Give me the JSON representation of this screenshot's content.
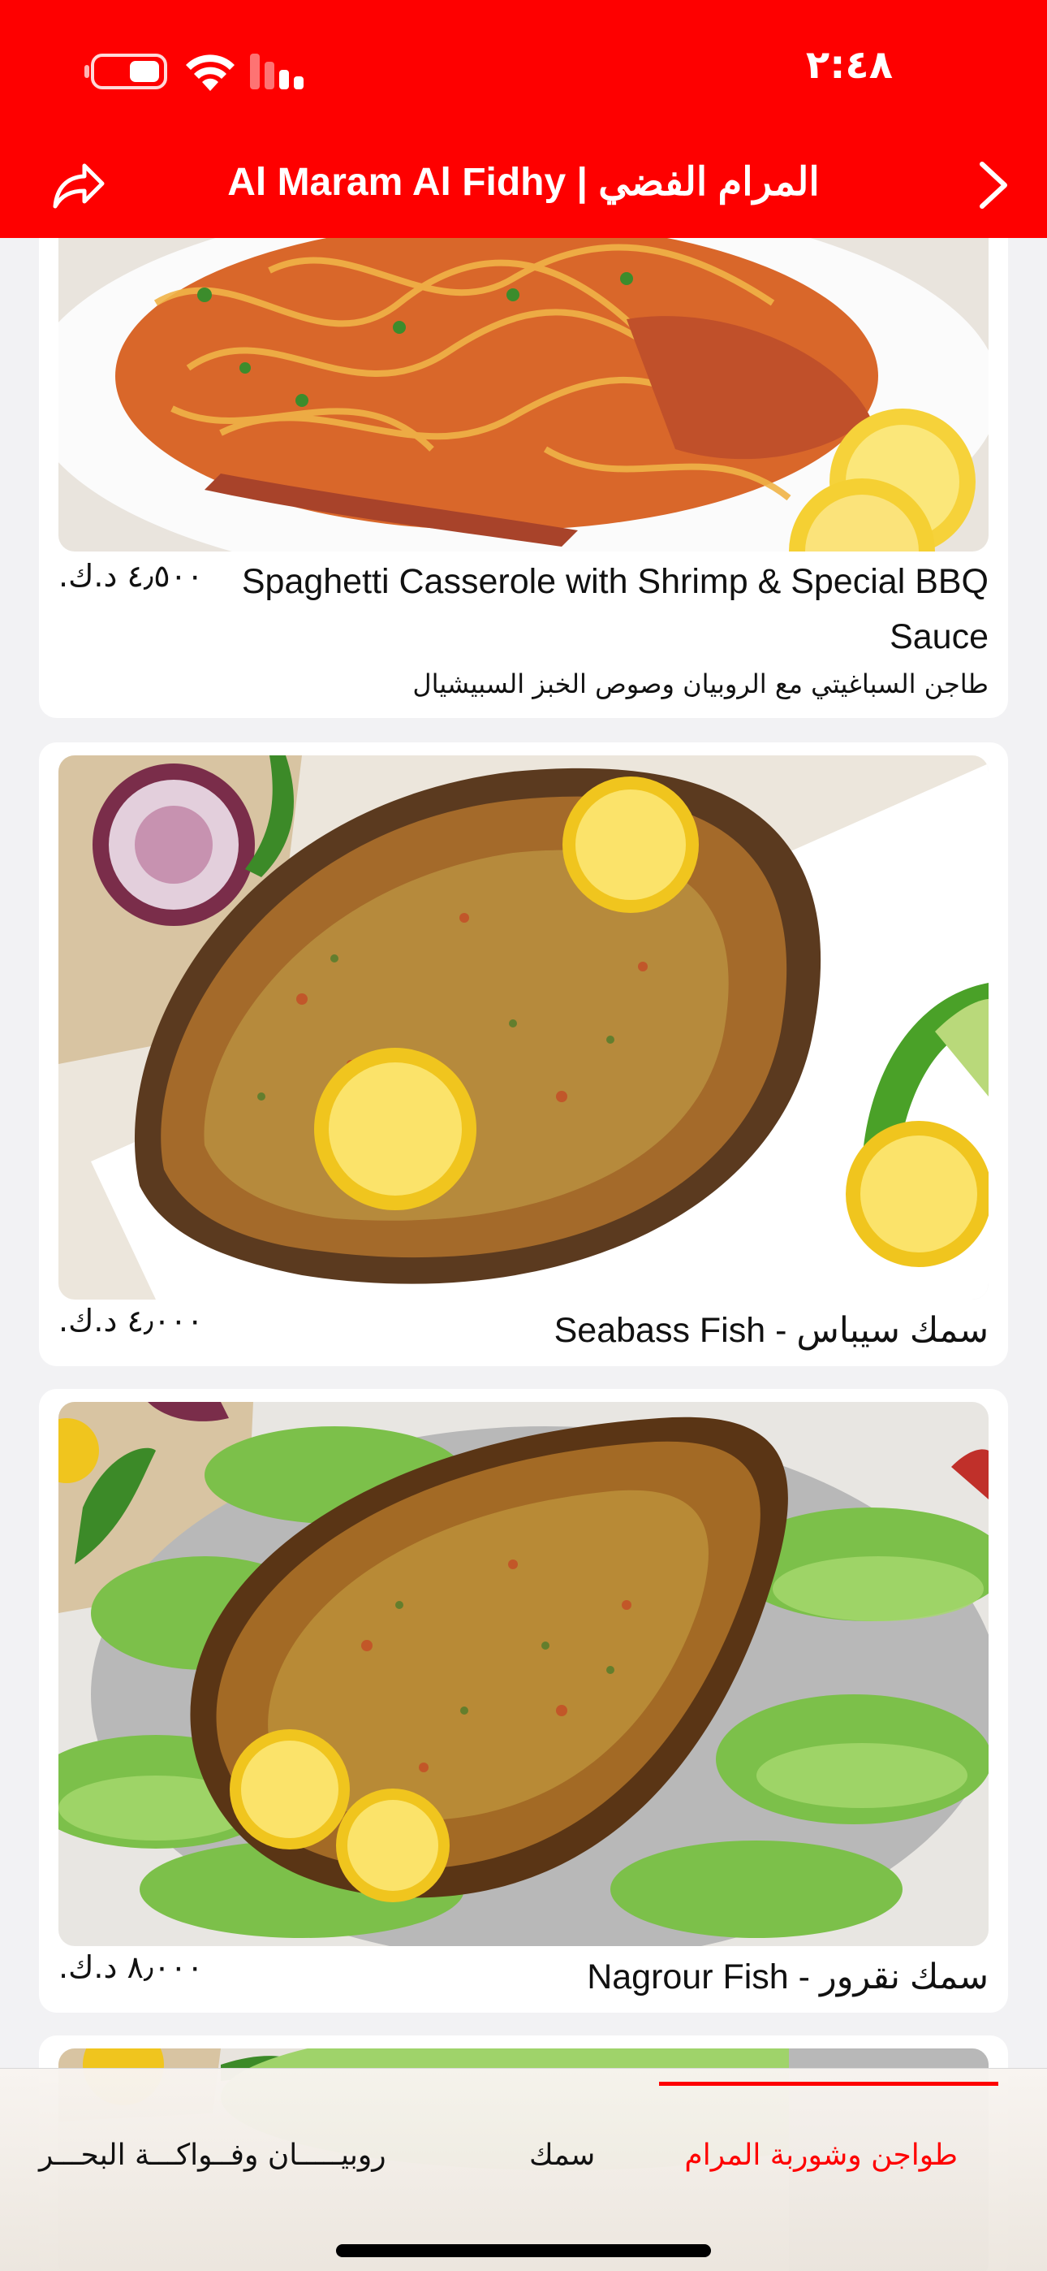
{
  "status_bar": {
    "time": "٢:٤٨"
  },
  "header": {
    "title": "Al Maram Al Fidhy | المرام الفضي"
  },
  "items": [
    {
      "name": "Spaghetti Casserole with Shrimp & Special BBQ Sauce",
      "description": "طاجن السباغيتي مع الروبيان وصوص الخبز السبيشيال",
      "price": "٤٫٥٠٠ د.ك."
    },
    {
      "name": "Seabass Fish - سمك سيباس",
      "price": "٤٫٠٠٠ د.ك."
    },
    {
      "name": "Nagrour Fish - سمك نقرور",
      "price": "٨٫٠٠٠ د.ك."
    }
  ],
  "tabs": [
    {
      "label": "طواجن وشوربة المرام",
      "active": true
    },
    {
      "label": "سمك",
      "active": false
    },
    {
      "label": "روبيـــــان وفــواكـــة البحـــر",
      "active": false
    }
  ],
  "colors": {
    "brand": "#fe0000",
    "background": "#f2f2f4"
  },
  "icons": [
    "share-icon",
    "chevron-right-icon",
    "battery-icon",
    "wifi-icon",
    "cellular-signal-icon"
  ]
}
